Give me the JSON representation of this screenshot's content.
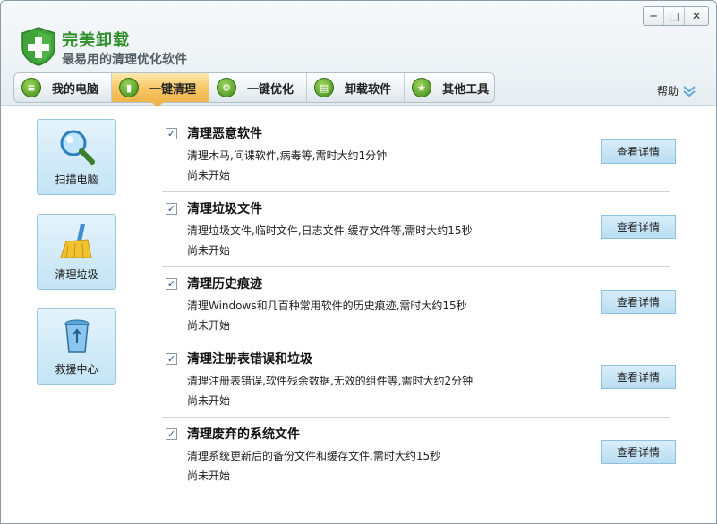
{
  "app": {
    "title": "完美卸载",
    "subtitle": "最易用的清理优化软件"
  },
  "window_controls": {
    "minimize": "─",
    "maximize": "□",
    "close": "✕"
  },
  "tabs": [
    {
      "label": "我的电脑",
      "icon": "computer-icon",
      "active": false
    },
    {
      "label": "一键清理",
      "icon": "trash-icon",
      "active": true
    },
    {
      "label": "一键优化",
      "icon": "gears-icon",
      "active": false
    },
    {
      "label": "卸载软件",
      "icon": "uninstall-icon",
      "active": false
    },
    {
      "label": "其他工具",
      "icon": "tools-icon",
      "active": false
    }
  ],
  "help": {
    "label": "帮助",
    "icon": "chevron-down-icon"
  },
  "sidebar": [
    {
      "label": "扫描电脑",
      "icon": "magnifier-icon"
    },
    {
      "label": "清理垃圾",
      "icon": "broom-icon"
    },
    {
      "label": "救援中心",
      "icon": "recycle-bin-icon"
    }
  ],
  "items": [
    {
      "checked": true,
      "title": "清理恶意软件",
      "desc": "清理木马,间谍软件,病毒等,需时大约1分钟",
      "status": "尚未开始",
      "button": "查看详情"
    },
    {
      "checked": true,
      "title": "清理垃圾文件",
      "desc": "清理垃圾文件,临时文件,日志文件,缓存文件等,需时大约15秒",
      "status": "尚未开始",
      "button": "查看详情"
    },
    {
      "checked": true,
      "title": "清理历史痕迹",
      "desc": "清理Windows和几百种常用软件的历史痕迹,需时大约15秒",
      "status": "尚未开始",
      "button": "查看详情"
    },
    {
      "checked": true,
      "title": "清理注册表错误和垃圾",
      "desc": "清理注册表错误,软件残余数据,无效的组件等,需时大约2分钟",
      "status": "尚未开始",
      "button": "查看详情"
    },
    {
      "checked": true,
      "title": "清理废弃的系统文件",
      "desc": "清理系统更新后的备份文件和缓存文件,需时大约15秒",
      "status": "尚未开始",
      "button": "查看详情"
    }
  ],
  "colors": {
    "brand_green": "#2f8f2a",
    "active_tab": "#f0b54a",
    "side_button": "#c4e4f5",
    "detail_button": "#b9ddf2"
  }
}
